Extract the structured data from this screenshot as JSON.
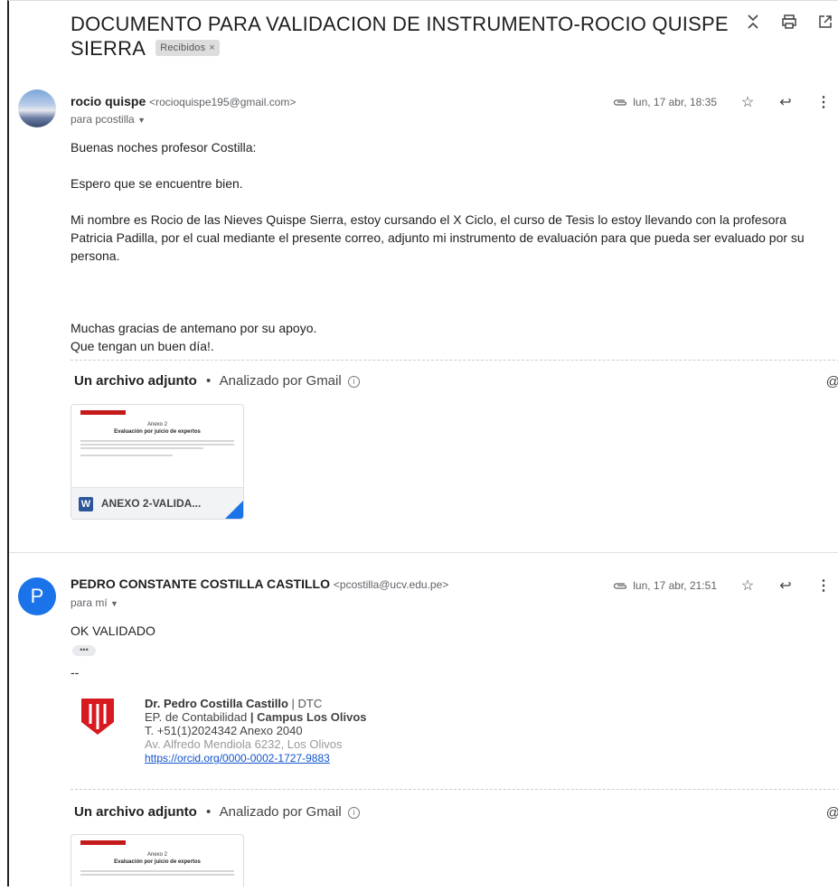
{
  "thread": {
    "subject": "DOCUMENTO PARA VALIDACION DE INSTRUMENTO-ROCIO QUISPE SIERRA",
    "label": "Recibidos",
    "label_close": "×",
    "icons": [
      "collapse-icon",
      "print-icon",
      "open-new-window-icon"
    ]
  },
  "message1": {
    "sender_name": "rocio quispe",
    "sender_email": "<rocioquispe195@gmail.com>",
    "to": "para pcostilla",
    "date": "lun, 17 abr, 18:35",
    "body": [
      "Buenas noches profesor Costilla:",
      "Espero que se encuentre bien.",
      "Mi nombre es Rocio de las Nieves Quispe Sierra, estoy cursando el X Ciclo, el curso de Tesis lo estoy llevando con la profesora Patricia Padilla, por el cual mediante el presente correo, adjunto mi instrumento de evaluación para que pueda ser evaluado por su persona.",
      "Muchas gracias de antemano por su apoyo.",
      "Que tengan un buen día!."
    ],
    "attach_title": "Un archivo adjunto",
    "attach_sep": "•",
    "attach_scan": "Analizado por Gmail",
    "file_name": "ANEXO 2-VALIDA...",
    "file_type": "W",
    "preview_title": "Anexo 2",
    "preview_subtitle": "Evaluación por juicio de expertos"
  },
  "message2": {
    "avatar_letter": "P",
    "sender_name": "PEDRO CONSTANTE COSTILLA CASTILLO",
    "sender_email": "<pcostilla@ucv.edu.pe>",
    "to": "para mí",
    "date": "lun, 17 abr, 21:51",
    "body": "OK VALIDADO",
    "dots": "•••",
    "dash": "--",
    "signature": {
      "name": "Dr. Pedro Costilla Castillo",
      "role": " | DTC",
      "school": "EP. de Contabilidad",
      "campus_sep": " | ",
      "campus": "Campus Los Olivos",
      "phone": "T. +51(1)2024342 Anexo 2040",
      "address": "Av. Alfredo Mendiola 6232,  Los Olivos",
      "orcid": "https://orcid.org/0000-0002-1727-9883"
    },
    "attach_title": "Un archivo adjunto",
    "attach_sep": "•",
    "attach_scan": "Analizado por Gmail",
    "preview_title": "Anexo 2",
    "preview_subtitle": "Evaluación por juicio de expertos"
  }
}
